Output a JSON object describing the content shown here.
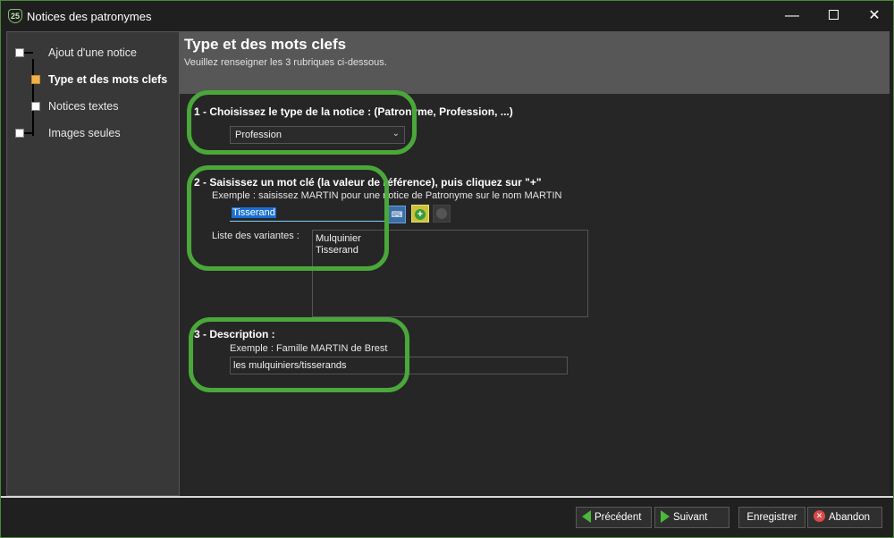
{
  "window": {
    "title": "Notices des patronymes",
    "app_icon_text": "25"
  },
  "sidebar": {
    "steps": [
      {
        "label": "Ajout d'une notice",
        "active": false
      },
      {
        "label": "Type et des mots clefs",
        "active": true
      },
      {
        "label": "Notices textes",
        "active": false
      },
      {
        "label": "Images seules",
        "active": false
      }
    ]
  },
  "header": {
    "title": "Type et des mots clefs",
    "subtitle": "Veuillez renseigner les 3 rubriques ci-dessous."
  },
  "section1": {
    "title": "1 - Choisissez le type de la notice : (Patronyme, Profession, ...)",
    "selected_type": "Profession"
  },
  "section2": {
    "title": "2 - Saisissez un mot clé (la valeur de référence), puis cliquez sur \"+\"",
    "example": "Exemple : saisissez MARTIN pour une notice de Patronyme sur le nom MARTIN",
    "keyword_value": "Tisserand",
    "variants_label": "Liste des variantes :",
    "variants": [
      "Mulquinier",
      "Tisserand"
    ]
  },
  "section3": {
    "title": "3 - Description :",
    "example": "Exemple :   Famille MARTIN de Brest",
    "description_value": "les mulquiniers/tisserands"
  },
  "footer": {
    "previous_label": "Précédent",
    "next_label": "Suivant",
    "save_label": "Enregistrer",
    "cancel_label": "Abandon"
  },
  "colors": {
    "highlight": "#4aa83a",
    "active_step": "#f0b24a",
    "selection": "#1a6fd1"
  }
}
